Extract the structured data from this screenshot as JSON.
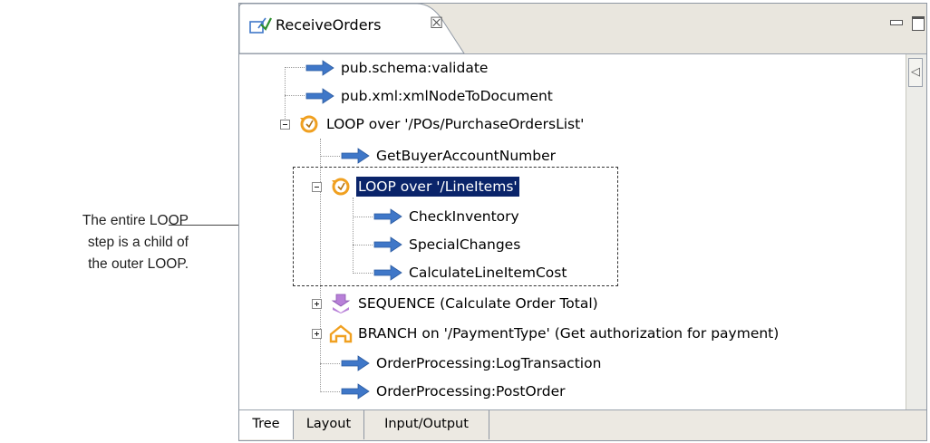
{
  "annotation": {
    "lines": [
      "The entire LOOP",
      "step is a child of",
      "the outer LOOP."
    ]
  },
  "editor": {
    "tab_title": "ReceiveOrders",
    "tab_close": "☒",
    "scroll_arrow": "◁"
  },
  "tree": [
    {
      "label": "pub.schema:validate",
      "icon": "invoke-arrow-icon"
    },
    {
      "label": "pub.xml:xmlNodeToDocument",
      "icon": "invoke-arrow-icon"
    },
    {
      "label": "LOOP over '/POs/PurchaseOrdersList'",
      "icon": "loop-icon",
      "expanded": true
    },
    {
      "label": "GetBuyerAccountNumber",
      "icon": "invoke-arrow-icon"
    },
    {
      "label": "LOOP over '/LineItems'",
      "icon": "loop-icon",
      "expanded": true,
      "selected": true
    },
    {
      "label": "CheckInventory",
      "icon": "invoke-arrow-icon"
    },
    {
      "label": "SpecialChanges",
      "icon": "invoke-arrow-icon"
    },
    {
      "label": "CalculateLineItemCost",
      "icon": "invoke-arrow-icon"
    },
    {
      "label": "SEQUENCE (Calculate Order Total)",
      "icon": "sequence-icon",
      "expanded": false
    },
    {
      "label": "BRANCH on '/PaymentType' (Get authorization for payment)",
      "icon": "branch-icon",
      "expanded": false
    },
    {
      "label": "OrderProcessing:LogTransaction",
      "icon": "invoke-arrow-icon"
    },
    {
      "label": "OrderProcessing:PostOrder",
      "icon": "invoke-arrow-icon"
    }
  ],
  "bottom_tabs": [
    {
      "label": "Tree",
      "active": true
    },
    {
      "label": "Layout",
      "active": false
    },
    {
      "label": "Input/Output",
      "active": false
    }
  ],
  "colors": {
    "selection": "#0a246a",
    "invoke_arrow": "#3f77c8",
    "loop_icon": "#f0a020",
    "sequence_icon": "#b880d8",
    "branch_icon": "#f0a020"
  }
}
